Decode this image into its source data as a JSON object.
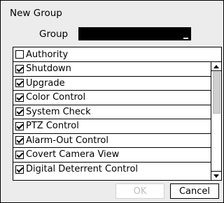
{
  "dialog": {
    "title": "New Group",
    "group_label": "Group",
    "group_value": ""
  },
  "authority": {
    "header_label": "Authority",
    "header_checked": false,
    "items": [
      {
        "label": "Shutdown",
        "checked": true
      },
      {
        "label": "Upgrade",
        "checked": true
      },
      {
        "label": "Color Control",
        "checked": true
      },
      {
        "label": "System Check",
        "checked": true
      },
      {
        "label": "PTZ Control",
        "checked": true
      },
      {
        "label": "Alarm-Out Control",
        "checked": true
      },
      {
        "label": "Covert Camera View",
        "checked": true
      },
      {
        "label": "Digital Deterrent Control",
        "checked": true
      }
    ]
  },
  "buttons": {
    "ok_label": "OK",
    "ok_enabled": false,
    "cancel_label": "Cancel"
  }
}
